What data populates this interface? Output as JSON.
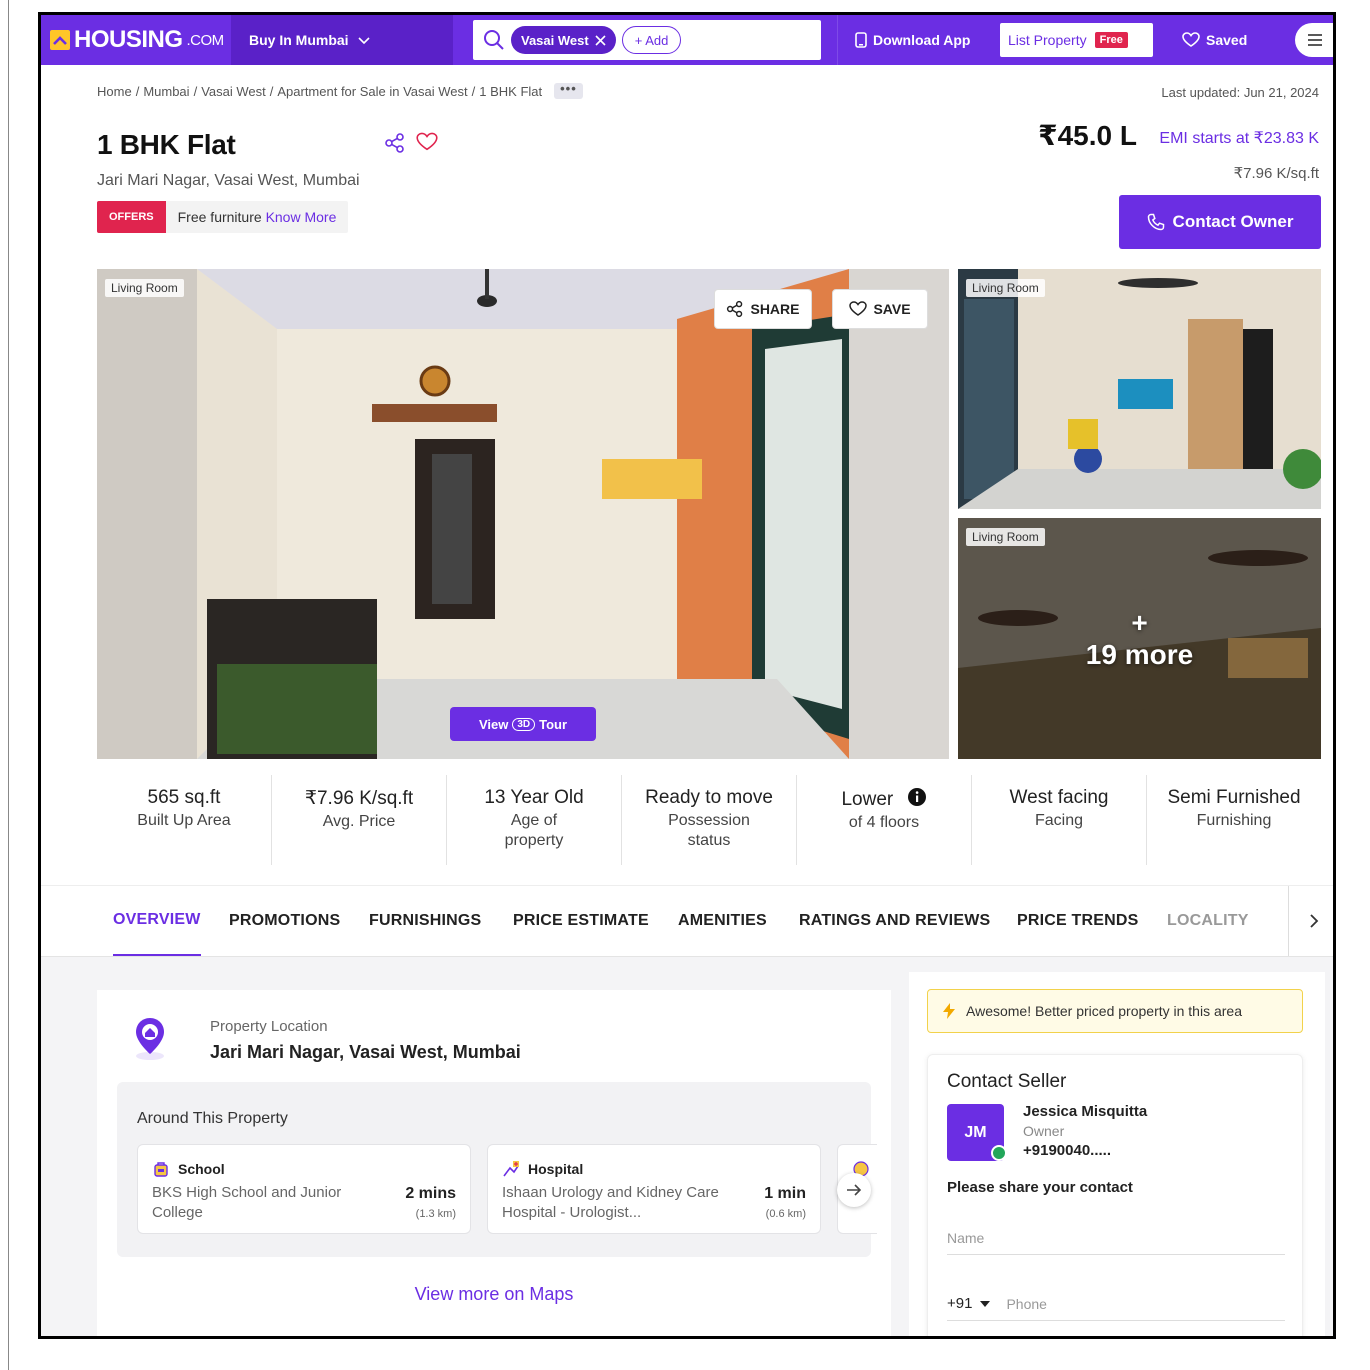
{
  "header": {
    "logo_text": "HOUSING",
    "logo_suffix": ".COM",
    "buy_dropdown": "Buy In Mumbai",
    "search_chip": "Vasai West",
    "add_chip": "+ Add",
    "download_app": "Download App",
    "list_property": "List Property",
    "free_badge": "Free",
    "saved": "Saved"
  },
  "breadcrumb": {
    "items": [
      "Home",
      "Mumbai",
      "Vasai West",
      "Apartment for Sale in Vasai West",
      "1 BHK Flat"
    ],
    "more": "•••",
    "separator": "/"
  },
  "last_updated": "Last updated: Jun 21, 2024",
  "listing": {
    "title": "1 BHK Flat",
    "location": "Jari Mari Nagar, Vasai West, Mumbai",
    "offer_tag": "OFFERS",
    "offer_text": "Free furniture",
    "offer_link": "Know More",
    "price": "₹45.0 L",
    "emi": "EMI starts at ₹23.83 K",
    "price_per_sqft": "₹7.96 K/sq.ft",
    "contact_button": "Contact Owner"
  },
  "gallery": {
    "main_label": "Living Room",
    "share": "SHARE",
    "save": "SAVE",
    "tour_prefix": "View",
    "tour_suffix": "Tour",
    "tour_badge": "3D",
    "right1_label": "Living Room",
    "right2_label": "Living Room",
    "more_plus": "+",
    "more_count": "19 more"
  },
  "stats": [
    {
      "value": "565 sq.ft",
      "label": "Built Up Area"
    },
    {
      "value": "₹7.96 K/sq.ft",
      "label": "Avg. Price"
    },
    {
      "value": "13 Year Old",
      "label": "Age of property"
    },
    {
      "value": "Ready to move",
      "label": "Possession status"
    },
    {
      "value": "Lower",
      "label": "of 4 floors"
    },
    {
      "value": "West facing",
      "label": "Facing"
    },
    {
      "value": "Semi Furnished",
      "label": "Furnishing"
    }
  ],
  "tabs": [
    "OVERVIEW",
    "PROMOTIONS",
    "FURNISHINGS",
    "PRICE ESTIMATE",
    "AMENITIES",
    "RATINGS AND REVIEWS",
    "PRICE TRENDS",
    "LOCALITY"
  ],
  "location_card": {
    "label": "Property Location",
    "address": "Jari Mari Nagar, Vasai West, Mumbai",
    "around_title": "Around This Property",
    "pois": [
      {
        "category": "School",
        "name": "BKS High School and Junior College",
        "time": "2 mins",
        "distance": "(1.3 km)"
      },
      {
        "category": "Hospital",
        "name": "Ishaan Urology and Kidney Care Hospital - Urologist...",
        "time": "1 min",
        "distance": "(0.6 km)"
      }
    ],
    "view_maps": "View more on Maps"
  },
  "side": {
    "banner": "Awesome! Better priced property in this area",
    "contact_title": "Contact Seller",
    "avatar_initials": "JM",
    "seller_name": "Jessica Misquitta",
    "seller_role": "Owner",
    "seller_phone": "+9190040.....",
    "share_prompt": "Please share your contact",
    "name_placeholder": "Name",
    "country_code": "+91",
    "phone_placeholder": "Phone"
  },
  "colors": {
    "brand": "#6b2ee3",
    "offer": "#e0244e",
    "logo_accent": "#ffc628"
  }
}
